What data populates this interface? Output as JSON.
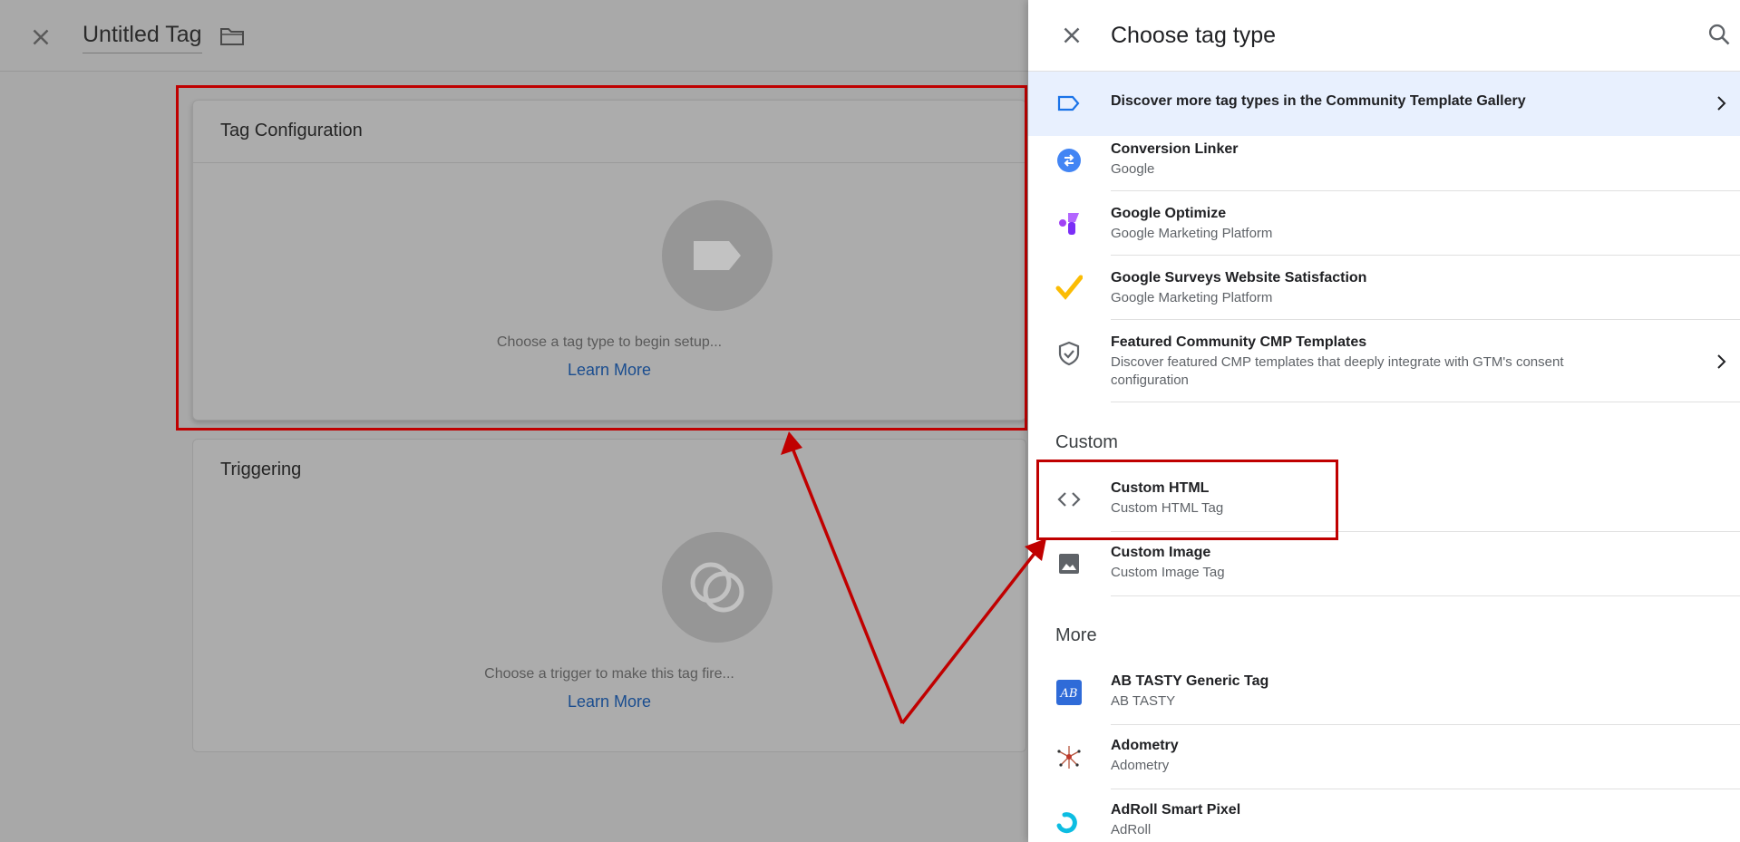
{
  "editor": {
    "title": "Untitled Tag",
    "tag_card": {
      "title": "Tag Configuration",
      "hint": "Choose a tag type to begin setup...",
      "link": "Learn More"
    },
    "trigger_card": {
      "title": "Triggering",
      "hint": "Choose a trigger to make this tag fire...",
      "link": "Learn More"
    }
  },
  "panel": {
    "title": "Choose tag type",
    "discover": "Discover more tag types in the Community Template Gallery",
    "featured_items": [
      {
        "name": "Conversion Linker",
        "sub": "Google",
        "icon": "conversion-linker-icon"
      },
      {
        "name": "Google Optimize",
        "sub": "Google Marketing Platform",
        "icon": "google-optimize-icon"
      },
      {
        "name": "Google Surveys Website Satisfaction",
        "sub": "Google Marketing Platform",
        "icon": "google-surveys-icon"
      },
      {
        "name": "Featured Community CMP Templates",
        "sub": "Discover featured CMP templates that deeply integrate with GTM's consent configuration",
        "icon": "shield-check-icon"
      }
    ],
    "custom_section": "Custom",
    "custom_items": [
      {
        "name": "Custom HTML",
        "sub": "Custom HTML Tag",
        "icon": "code-brackets-icon"
      },
      {
        "name": "Custom Image",
        "sub": "Custom Image Tag",
        "icon": "image-icon"
      }
    ],
    "more_section": "More",
    "more_items": [
      {
        "name": "AB TASTY Generic Tag",
        "sub": "AB TASTY",
        "icon": "ab-tasty-icon"
      },
      {
        "name": "Adometry",
        "sub": "Adometry",
        "icon": "adometry-icon"
      },
      {
        "name": "AdRoll Smart Pixel",
        "sub": "AdRoll",
        "icon": "adroll-icon"
      }
    ]
  },
  "colors": {
    "highlight_red": "#c00000",
    "discover_bg": "#e8f0fe",
    "link_blue": "#1a4d8f"
  }
}
